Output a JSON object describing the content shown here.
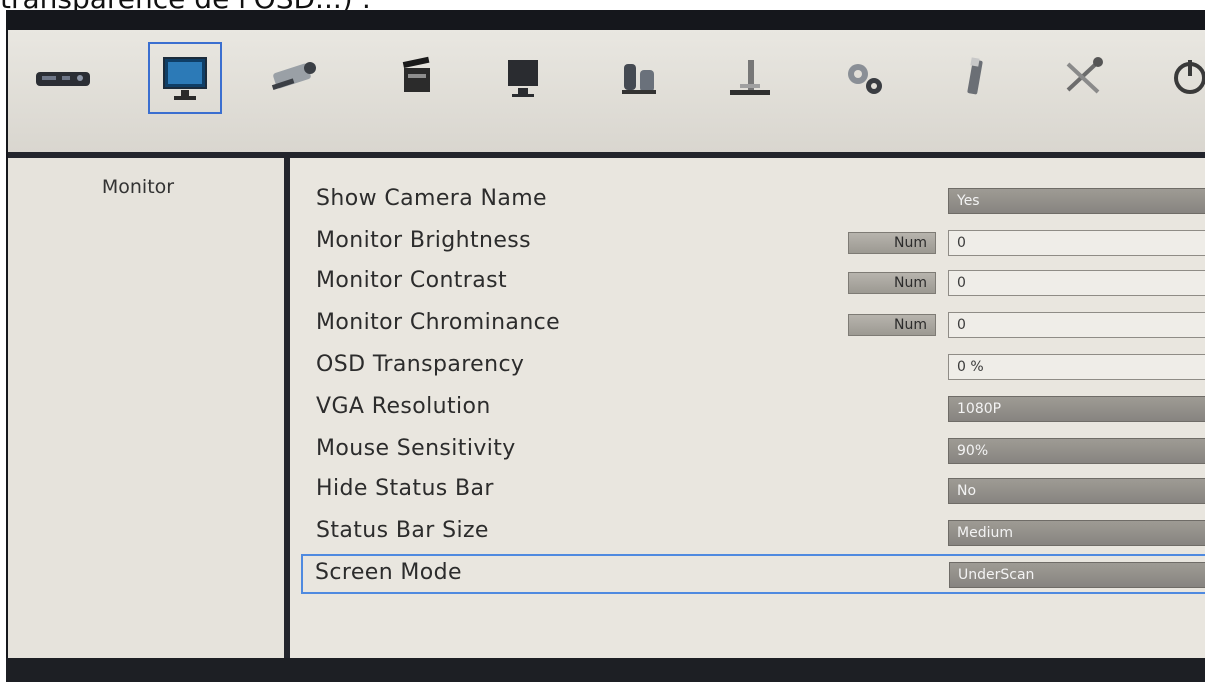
{
  "page": {
    "top_text": "transparence de l'OSD...) :"
  },
  "toolbar": {
    "icons": [
      {
        "name": "dvr-device-icon",
        "selected": false
      },
      {
        "name": "monitor-icon",
        "selected": true
      },
      {
        "name": "camera-icon",
        "selected": false
      },
      {
        "name": "record-clapper-icon",
        "selected": false
      },
      {
        "name": "display-icon",
        "selected": false
      },
      {
        "name": "network-icon",
        "selected": false
      },
      {
        "name": "storage-stand-icon",
        "selected": false
      },
      {
        "name": "gears-icon",
        "selected": false
      },
      {
        "name": "usb-icon",
        "selected": false
      },
      {
        "name": "tools-icon",
        "selected": false
      },
      {
        "name": "power-icon",
        "selected": false
      }
    ]
  },
  "sidebar": {
    "title": "Monitor"
  },
  "settings": {
    "rows": [
      {
        "label": "Show Camera Name",
        "value": "Yes",
        "has_num": false
      },
      {
        "label": "Monitor Brightness",
        "value": "0",
        "has_num": true
      },
      {
        "label": "Monitor Contrast",
        "value": "0",
        "has_num": true
      },
      {
        "label": "Monitor Chrominance",
        "value": "0",
        "has_num": true
      },
      {
        "label": "OSD Transparency",
        "value": "0 %",
        "has_num": false
      },
      {
        "label": "VGA Resolution",
        "value": "1080P",
        "has_num": false
      },
      {
        "label": "Mouse Sensitivity",
        "value": "90%",
        "has_num": false
      },
      {
        "label": "Hide Status Bar",
        "value": "No",
        "has_num": false
      },
      {
        "label": "Status Bar Size",
        "value": "Medium",
        "has_num": false
      },
      {
        "label": "Screen Mode",
        "value": "UnderScan",
        "has_num": false
      }
    ],
    "num_label": "Num"
  },
  "colors": {
    "selection_border": "#4f8ae0",
    "toolbar_bg": "#e2dfd8",
    "panel_bg": "#e9e6df",
    "dark_frame": "#1d1f24"
  }
}
